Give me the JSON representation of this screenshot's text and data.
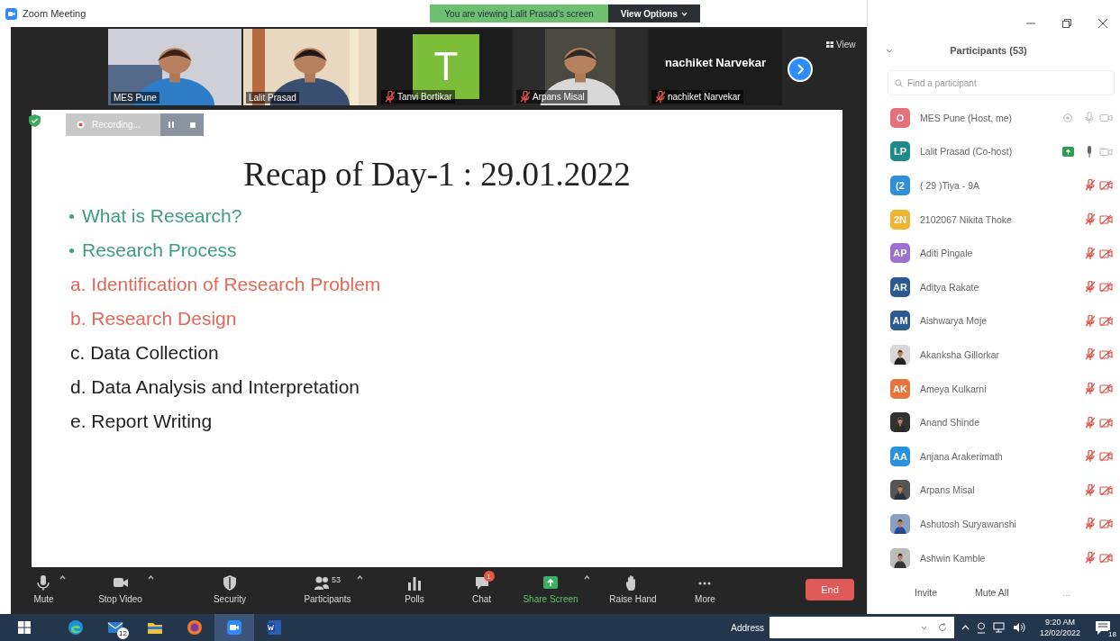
{
  "window": {
    "title": "Zoom Meeting"
  },
  "banner": {
    "text": "You are viewing Lalit Prasad's screen",
    "options": "View Options"
  },
  "thumbnails": [
    {
      "name": "MES Pune",
      "kind": "video",
      "muted": false
    },
    {
      "name": "Lalit Prasad",
      "kind": "video",
      "muted": false
    },
    {
      "name": "Tanvi Bortikar",
      "kind": "initial",
      "initial": "T",
      "muted": true
    },
    {
      "name": "Arpans Misal",
      "kind": "video",
      "muted": true
    },
    {
      "name": "nachiket Narvekar",
      "kind": "name",
      "display": "nachiket Narvekar",
      "muted": true
    }
  ],
  "view_label": "View",
  "recording": {
    "label": "Recording..."
  },
  "slide": {
    "title": "Recap of Day-1 : 29.01.2022",
    "items": [
      {
        "text": "What is Research?",
        "kind": "bullet",
        "color": "#3e9c84"
      },
      {
        "text": "Research Process",
        "kind": "bullet",
        "color": "#3e9c84"
      },
      {
        "text": "a. Identification of Research Problem",
        "kind": "lettered",
        "color": "#e2685a"
      },
      {
        "text": "b. Research Design",
        "kind": "lettered",
        "color": "#e2685a"
      },
      {
        "text": "c. Data Collection",
        "kind": "lettered",
        "color": "#222222"
      },
      {
        "text": "d. Data Analysis and Interpretation",
        "kind": "lettered",
        "color": "#222222"
      },
      {
        "text": "e. Report Writing",
        "kind": "lettered",
        "color": "#222222"
      }
    ]
  },
  "toolbar": [
    {
      "label": "Mute",
      "kind": "mic",
      "caret": true,
      "highlight": false
    },
    {
      "label": "Stop Video",
      "kind": "video",
      "caret": true,
      "highlight": false
    },
    {
      "label": "Security",
      "kind": "security",
      "caret": false,
      "highlight": false
    },
    {
      "label": "Participants",
      "kind": "people",
      "caret": true,
      "count": "53",
      "highlight": false
    },
    {
      "label": "Polls",
      "kind": "polls",
      "caret": false,
      "highlight": false
    },
    {
      "label": "Chat",
      "kind": "chat",
      "caret": false,
      "badge": "1",
      "highlight": false
    },
    {
      "label": "Share Screen",
      "kind": "share",
      "caret": true,
      "highlight": true
    },
    {
      "label": "Raise Hand",
      "kind": "hand",
      "caret": false,
      "highlight": false
    },
    {
      "label": "More",
      "kind": "more",
      "caret": false,
      "highlight": false
    }
  ],
  "end_button": "End",
  "panel": {
    "title": "Participants (53)",
    "search_placeholder": "Find a participant",
    "participants": [
      {
        "name": "MES Pune (Host, me)",
        "kind": "initials",
        "initials": "O",
        "color": "#e8707a",
        "muted": false,
        "talking": false,
        "sharing": false,
        "recording": true
      },
      {
        "name": "Lalit Prasad (Co-host)",
        "kind": "initials",
        "initials": "LP",
        "color": "#1f8a8c",
        "muted": false,
        "talking": true,
        "sharing": true,
        "recording": false
      },
      {
        "name": "( 29 )Tiya - 9A",
        "kind": "initials",
        "initials": "(2",
        "color": "#2f8fd8",
        "muted": true,
        "talking": false,
        "sharing": false,
        "recording": false
      },
      {
        "name": "2102067 Nikita Thoke",
        "kind": "initials",
        "initials": "2N",
        "color": "#f0b434",
        "muted": true,
        "talking": false,
        "sharing": false,
        "recording": false
      },
      {
        "name": "Aditi Pingale",
        "kind": "initials",
        "initials": "AP",
        "color": "#a070d0",
        "muted": true,
        "talking": false,
        "sharing": false,
        "recording": false
      },
      {
        "name": "Aditya Rakate",
        "kind": "initials",
        "initials": "AR",
        "color": "#2a5a90",
        "muted": true,
        "talking": false,
        "sharing": false,
        "recording": false
      },
      {
        "name": "Aishwarya Moje",
        "kind": "initials",
        "initials": "AM",
        "color": "#2a5a90",
        "muted": true,
        "talking": false,
        "sharing": false,
        "recording": false
      },
      {
        "name": "Akanksha Gillorkar",
        "muted": true,
        "talking": false,
        "sharing": false,
        "recording": false
      },
      {
        "name": "Ameya Kulkarni",
        "kind": "initials",
        "initials": "AK",
        "color": "#e8743c",
        "muted": true,
        "talking": false,
        "sharing": false,
        "recording": false
      },
      {
        "name": "Anand Shinde",
        "muted": true,
        "talking": false,
        "sharing": false,
        "recording": false
      },
      {
        "name": "Anjana Arakerimath",
        "kind": "initials",
        "initials": "AA",
        "color": "#2a90e0",
        "muted": true,
        "talking": false,
        "sharing": false,
        "recording": false
      },
      {
        "name": "Arpans Misal",
        "muted": true,
        "talking": false,
        "sharing": false,
        "recording": false
      },
      {
        "name": "Ashutosh Suryawanshi",
        "muted": true,
        "talking": false,
        "sharing": false,
        "recording": false
      },
      {
        "name": "Ashwin Kamble",
        "muted": true,
        "talking": false,
        "sharing": false,
        "recording": false
      }
    ],
    "footer": [
      "Invite",
      "Mute All",
      "..."
    ]
  },
  "taskbar": {
    "apps": [
      {
        "kind": "edge",
        "selected": false
      },
      {
        "kind": "mail",
        "badge": "12",
        "selected": false
      },
      {
        "kind": "files",
        "selected": false
      },
      {
        "kind": "firefox",
        "selected": false
      },
      {
        "kind": "zoom",
        "selected": true
      },
      {
        "kind": "word",
        "selected": false
      }
    ],
    "address_label": "Address",
    "time": "9:20 AM",
    "date": "12/02/2022",
    "notifications": "18"
  }
}
